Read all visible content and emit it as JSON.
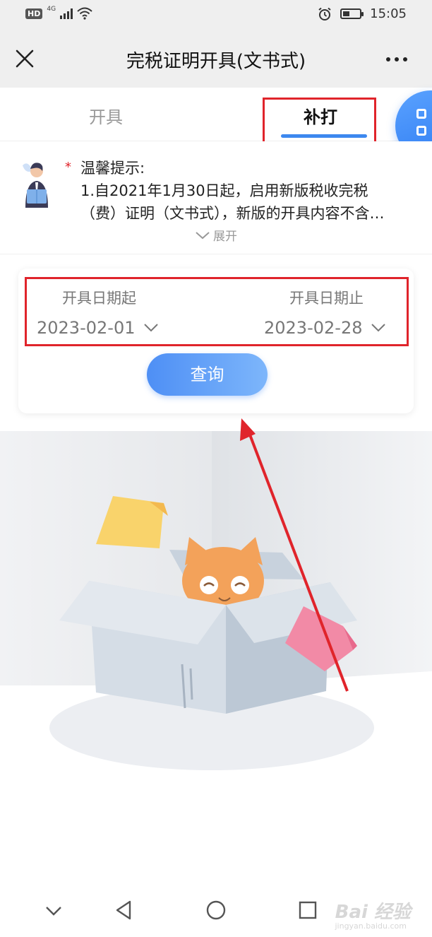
{
  "status_bar": {
    "hd": "HD",
    "network": "4G",
    "time": "15:05",
    "icons": [
      "signal-icon",
      "wifi-icon",
      "alarm-icon",
      "battery-icon"
    ]
  },
  "header": {
    "title": "完税证明开具(文书式)",
    "close_icon": "close-icon",
    "more_icon": "more-icon"
  },
  "tabs": [
    {
      "label": "开具",
      "active": false
    },
    {
      "label": "补打",
      "active": true
    }
  ],
  "notice": {
    "title": "温馨提示:",
    "line1": "1.自2021年1月30日起，启用新版税收完税",
    "line2": "（费）证明（文书式），新版的开具内容不含…",
    "expand_label": "展开"
  },
  "query": {
    "start_label": "开具日期起",
    "start_value": "2023-02-01",
    "end_label": "开具日期止",
    "end_value": "2023-02-28",
    "button_label": "查询"
  },
  "watermark": {
    "text": "Bai 经验",
    "sub": "jingyan.baidu.com"
  },
  "colors": {
    "accent": "#3d88ef",
    "highlight_red": "#e0242b",
    "button_start": "#4e8ff5",
    "button_end": "#7db6fb"
  }
}
